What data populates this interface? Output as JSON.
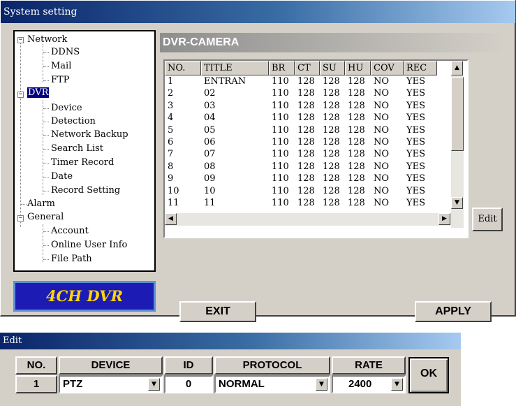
{
  "window": {
    "title": "System setting"
  },
  "tree": {
    "network": "Network",
    "ddns": "DDNS",
    "mail": "Mail",
    "ftp": "FTP",
    "dvr": "DVR",
    "device": "Device",
    "detection": "Detection",
    "network_backup": "Network Backup",
    "search_list": "Search List",
    "timer_record": "Timer Record",
    "date": "Date",
    "record_setting": "Record Setting",
    "alarm": "Alarm",
    "general": "General",
    "account": "Account",
    "online_user_info": "Online User Info",
    "file_path": "File Path"
  },
  "logo": "4CH DVR",
  "panel": {
    "title": "DVR-CAMERA"
  },
  "table": {
    "columns": [
      "NO.",
      "TITLE",
      "BR",
      "CT",
      "SU",
      "HU",
      "COV",
      "REC"
    ],
    "rows": [
      [
        "1",
        "ENTRAN",
        "110",
        "128",
        "128",
        "128",
        "NO",
        "YES"
      ],
      [
        "2",
        "02",
        "110",
        "128",
        "128",
        "128",
        "NO",
        "YES"
      ],
      [
        "3",
        "03",
        "110",
        "128",
        "128",
        "128",
        "NO",
        "YES"
      ],
      [
        "4",
        "04",
        "110",
        "128",
        "128",
        "128",
        "NO",
        "YES"
      ],
      [
        "5",
        "05",
        "110",
        "128",
        "128",
        "128",
        "NO",
        "YES"
      ],
      [
        "6",
        "06",
        "110",
        "128",
        "128",
        "128",
        "NO",
        "YES"
      ],
      [
        "7",
        "07",
        "110",
        "128",
        "128",
        "128",
        "NO",
        "YES"
      ],
      [
        "8",
        "08",
        "110",
        "128",
        "128",
        "128",
        "NO",
        "YES"
      ],
      [
        "9",
        "09",
        "110",
        "128",
        "128",
        "128",
        "NO",
        "YES"
      ],
      [
        "10",
        "10",
        "110",
        "128",
        "128",
        "128",
        "NO",
        "YES"
      ],
      [
        "11",
        "11",
        "110",
        "128",
        "128",
        "128",
        "NO",
        "YES"
      ]
    ]
  },
  "buttons": {
    "edit": "Edit",
    "exit": "EXIT",
    "apply": "APPLY"
  },
  "edit_window": {
    "title": "Edit",
    "headers": {
      "no": "NO.",
      "device": "DEVICE",
      "id": "ID",
      "protocol": "PROTOCOL",
      "rate": "RATE"
    },
    "values": {
      "no": "1",
      "device": "PTZ",
      "id": "0",
      "protocol": "NORMAL",
      "rate": "2400"
    },
    "ok": "OK"
  },
  "colors": {
    "titlebar_start": "#0a246a",
    "titlebar_end": "#a6caf0",
    "logo_bg": "#1c1cb4",
    "logo_text": "#ffd700",
    "face": "#d4d0c8"
  }
}
